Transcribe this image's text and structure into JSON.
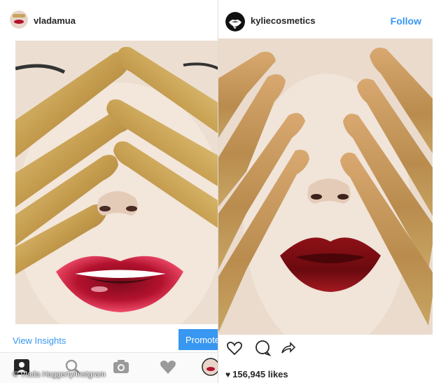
{
  "left_post": {
    "username": "vladamua",
    "avatar_icon": "avatar-photo",
    "view_insights_label": "View Insights",
    "promote_label": "Promote",
    "lip_color": "#b3122e"
  },
  "right_post": {
    "username": "kyliecosmetics",
    "avatar_icon": "kylie-lips-logo",
    "follow_label": "Follow",
    "likes_count": "156,945 likes",
    "lip_color": "#8e1116",
    "actions": [
      "heart-icon",
      "comment-icon",
      "share-icon"
    ]
  },
  "tabbar": {
    "icons": [
      "profile-icon",
      "search-icon",
      "camera-icon",
      "heart-icon",
      "avatar-icon"
    ]
  },
  "colors": {
    "accent": "#3897f0",
    "gold": "#c7a45a",
    "skin": "#efe3d8"
  },
  "credit": "© Vlada Haggerty/Instgram"
}
